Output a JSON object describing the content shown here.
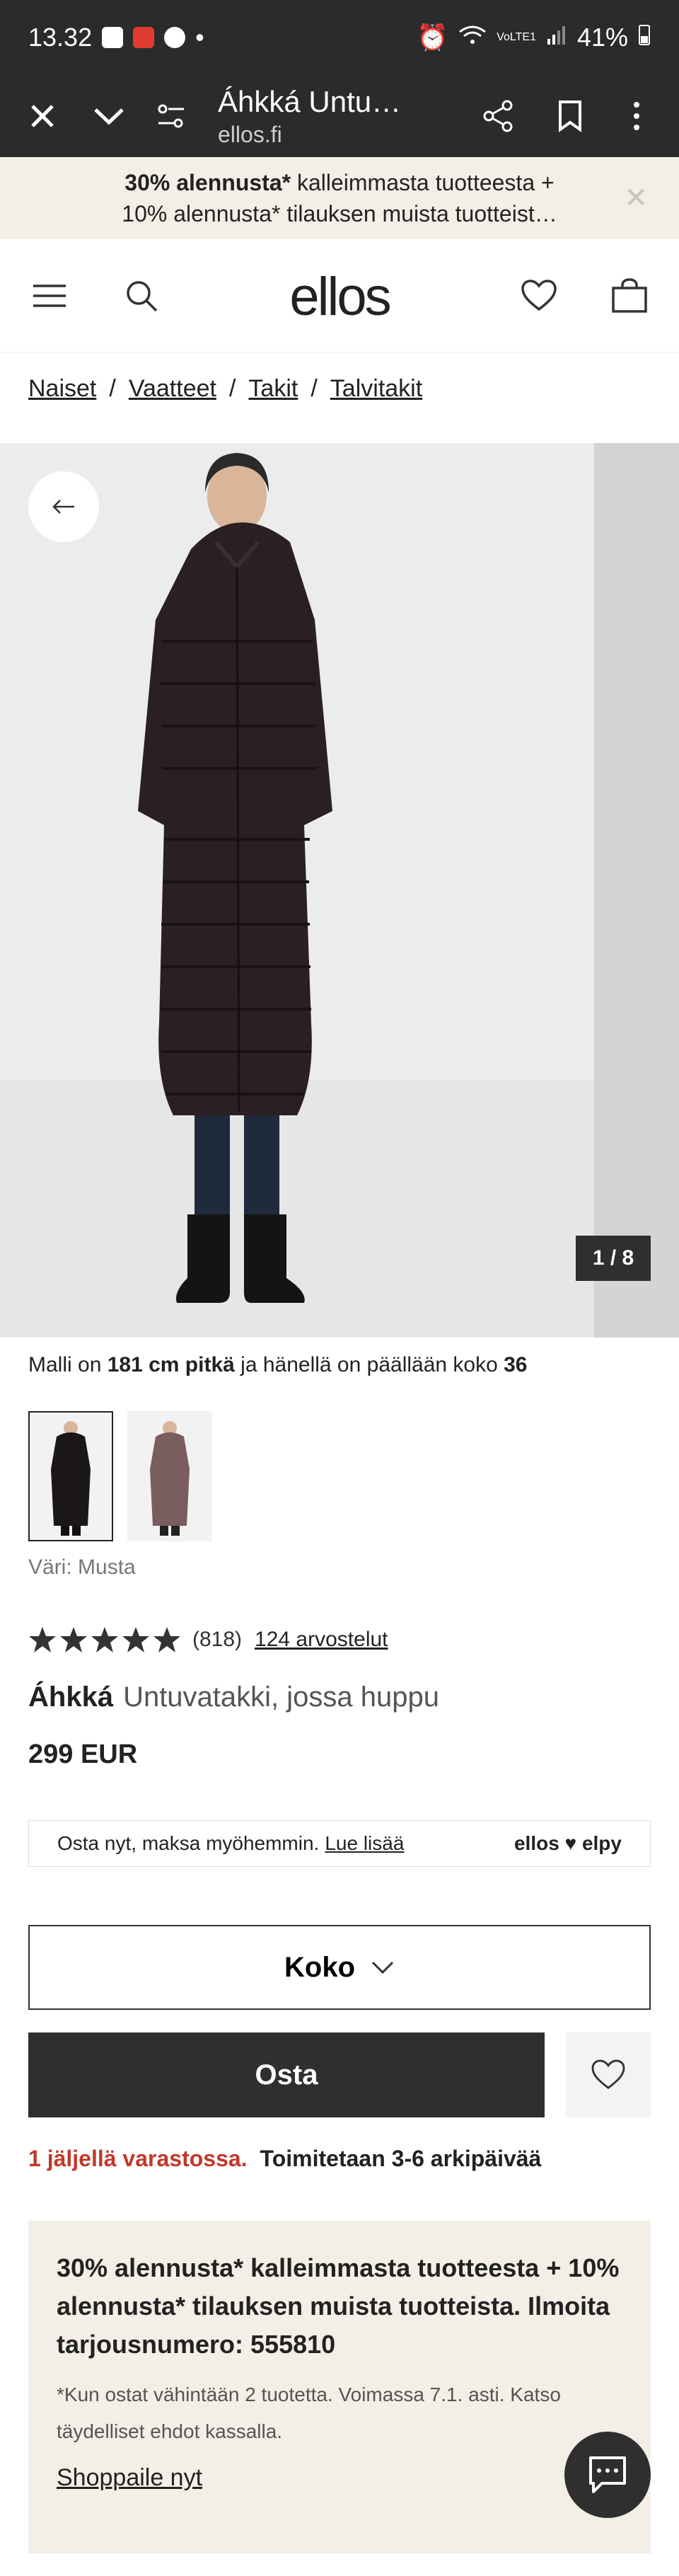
{
  "status_bar": {
    "time": "13.32",
    "dot": "•",
    "battery": "41%",
    "network": "VoLTE1"
  },
  "browser": {
    "title": "Áhkká Untu…",
    "url": "ellos.fi"
  },
  "promo_banner": {
    "bold": "30% alennusta*",
    "text_1": "kalleimmasta tuotteesta +",
    "text_2": "10% alennusta* tilauksen muista tuotteist…"
  },
  "header": {
    "logo": "ellos"
  },
  "breadcrumb": [
    "Naiset",
    "Vaatteet",
    "Takit",
    "Talvitakit"
  ],
  "gallery": {
    "counter": "1 / 8"
  },
  "model_info": {
    "prefix": "Malli on ",
    "height": "181 cm pitkä",
    "middle": " ja hänellä on päällään koko ",
    "size": "36"
  },
  "color": {
    "label": "Väri: Musta"
  },
  "rating": {
    "stars": 5,
    "count": "(818)",
    "reviews_link": "124 arvostelut"
  },
  "product": {
    "brand": "Áhkká",
    "name": "Untuvatakki, jossa huppu",
    "price": "299 EUR"
  },
  "paylater": {
    "text": "Osta nyt, maksa myöhemmin.",
    "link": "Lue lisää",
    "logos": "ellos ♥ elpy"
  },
  "size_button": {
    "label": "Koko"
  },
  "buy_button": {
    "label": "Osta"
  },
  "stock": {
    "left": "1 jäljellä varastossa.",
    "shipping": "Toimitetaan 3-6 arkipäivää"
  },
  "offer": {
    "headline": "30% alennusta* kalleimmasta tuotteesta + 10% alennusta* tilauksen muista tuotteista. Ilmoita tarjousnumero: 555810",
    "fine_print": "*Kun ostat vähintään 2 tuotetta. Voimassa 7.1. asti. Katso täydelliset ehdot kassalla.",
    "link": "Shoppaile nyt"
  },
  "colors": {
    "dark": "#2f2f2f",
    "beige": "#f3efe7",
    "accent_red": "#c0392b",
    "coat": "#2a1f22"
  }
}
